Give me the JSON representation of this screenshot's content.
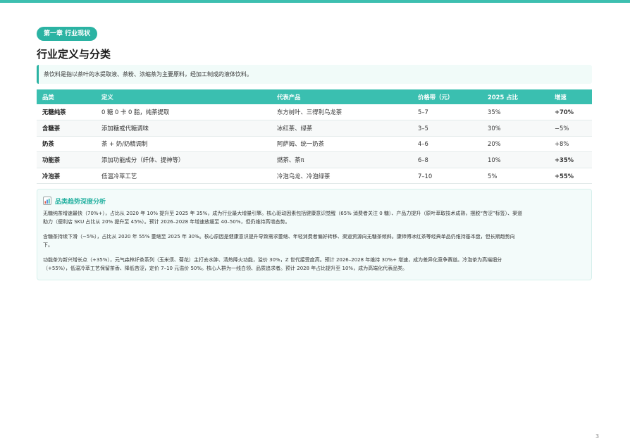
{
  "header": {
    "chapter_badge": "第一章 行业现状",
    "title": "行业定义与分类",
    "definition": "茶饮料是指以茶叶的水提取液、茶粉、浓缩茶为主要原料，经加工制成的液体饮料。"
  },
  "table": {
    "columns": [
      "品类",
      "定义",
      "代表产品",
      "价格带（元）",
      "2025 占比",
      "增速"
    ],
    "rows": [
      {
        "category": "无糖纯茶",
        "definition": "0 糖 0 卡 0 脂，纯茶提取",
        "products": "东方树叶、三得利乌龙茶",
        "price": "5–7",
        "share": "35%",
        "growth": "+70%",
        "trend": "up"
      },
      {
        "category": "含糖茶",
        "definition": "添加糖或代糖调味",
        "products": "冰红茶、绿茶",
        "price": "3–5",
        "share": "30%",
        "growth": "−5%",
        "trend": "down"
      },
      {
        "category": "奶茶",
        "definition": "茶 + 奶/奶精调制",
        "products": "阿萨姆、统一奶茶",
        "price": "4–6",
        "share": "20%",
        "growth": "+8%",
        "trend": "flat"
      },
      {
        "category": "功能茶",
        "definition": "添加功能成分（纤体、提神等）",
        "products": "燃茶、茶π",
        "price": "6–8",
        "share": "10%",
        "growth": "+35%",
        "trend": "up"
      },
      {
        "category": "冷泡茶",
        "definition": "低温冷萃工艺",
        "products": "冷泡乌龙、冷泡绿茶",
        "price": "7–10",
        "share": "5%",
        "growth": "+55%",
        "trend": "up"
      }
    ]
  },
  "analysis": {
    "icon": "chart-icon",
    "title": "品类趋势深度分析",
    "para1_line1": "无糖纯茶增速最快（70%+），占比从 2020 年 10% 提升至 2025 年 35%，成为行业最大增量引擎。核心驱动因素包括健康意识觉醒（65% 消费者关注 0 糖）、产品力提升（原叶萃取技术成熟，摆脱“苦涩”标签）、渠道",
    "para1_line2": "助力（便利店 SKU 占比从 20% 提升至 45%）。预计 2026–2028 年增速放缓至 40–50%，但仍维持高增态势。",
    "para2_line1": "含糖茶持续下滑（−5%），占比从 2020 年 55% 萎缩至 2025 年 30%。核心原因是健康意识提升导致需求萎缩、年轻消费者偏好转移、渠道资源向无糖茶倾斜。康师傅冰红茶等经典单品仍维持基本盘，但长期趋势向",
    "para2_line2": "下。",
    "para3_line1": "功能茶为新兴增长点（+35%），元气森林纤茶系列（玉米须、菊花）主打去水肿、清热降火功能，溢价 30%，Z 世代接受度高。预计 2026–2028 年维持 30%+ 增速，成为差异化竞争赛道。冷泡茶为高端细分",
    "para3_line2": "（+55%），低温冷萃工艺保留茶香、降低苦涩，定价 7–10 元溢价 50%。核心人群为一线白领、品质追求者。预计 2028 年占比提升至 10%，成为高端化代表品类。"
  },
  "footer": {
    "page_number": "3"
  },
  "colors": {
    "accent": "#2bb3a3",
    "growth_up": "#2bb3a3",
    "growth_down": "#e0533d"
  }
}
